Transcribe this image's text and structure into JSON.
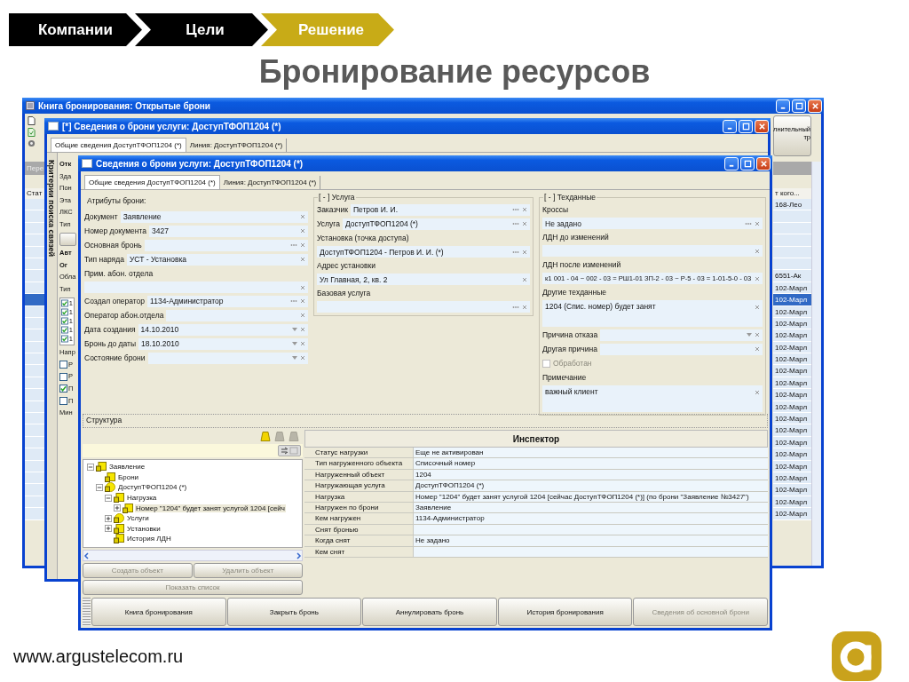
{
  "slide": {
    "breadcrumb": [
      {
        "label": "Компании",
        "selected": false
      },
      {
        "label": "Цели",
        "selected": false
      },
      {
        "label": "Решение",
        "selected": true
      }
    ],
    "title": "Бронирование ресурсов",
    "footer_url": "www.argustelecom.ru"
  },
  "back_window": {
    "title": "Книга бронирования: Открытые брони",
    "group_header": "Пере",
    "filter_button": [
      "лнительный",
      "тр"
    ],
    "columns": [
      {
        "header": "Стат"
      },
      {
        "header": "т кого..."
      }
    ],
    "rows": [
      {
        "column_2": "168-Лео",
        "selected": false
      },
      {
        "selected": false
      },
      {
        "selected": false
      },
      {
        "selected": false
      },
      {
        "selected": false
      },
      {
        "selected": false
      },
      {
        "column_2": "6551-Ак",
        "selected": false
      },
      {
        "column_2": "102-Марл",
        "selected": false
      },
      {
        "column_2": "102-Марл",
        "selected": true
      },
      {
        "column_2": "102-Марл",
        "selected": false
      },
      {
        "column_2": "102-Марл",
        "selected": false
      },
      {
        "column_2": "102-Марл",
        "selected": false
      },
      {
        "column_2": "102-Марл",
        "selected": false
      },
      {
        "column_2": "102-Марл",
        "selected": false
      },
      {
        "column_2": "102-Марл",
        "selected": false
      },
      {
        "column_2": "102-Марл",
        "selected": false
      },
      {
        "column_2": "102-Марл",
        "selected": false
      },
      {
        "column_2": "102-Марл",
        "selected": false
      },
      {
        "column_2": "102-Марл",
        "selected": false
      },
      {
        "column_2": "102-Марл",
        "selected": false
      },
      {
        "column_2": "102-Марл",
        "selected": false
      },
      {
        "column_2": "102-Марл",
        "selected": false
      },
      {
        "column_2": "102-Марл",
        "selected": false
      },
      {
        "column_2": "102-Марл",
        "selected": false
      },
      {
        "column_2": "102-Марл",
        "selected": false
      },
      {
        "column_2": "102-Марл",
        "selected": false
      },
      {
        "column_2": "102-Марл",
        "selected": false
      }
    ]
  },
  "middle_window": {
    "title": "[*] Сведения о брони услуги: ДоступТФОП1204 (*)",
    "tabs": [
      {
        "label": "Общие сведения  ДоступТФОП1204 (*)",
        "selected": true
      },
      {
        "label": "Линия: ДоступТФОП1204 (*)",
        "selected": false
      }
    ],
    "side_tab": "Критерии поиска связей",
    "filter_panel": [
      {
        "kind": "heading",
        "text": "Отк"
      },
      {
        "kind": "label",
        "text": "Зда"
      },
      {
        "kind": "label",
        "text": "Пон"
      },
      {
        "kind": "label",
        "text": "Эта"
      },
      {
        "kind": "label",
        "text": "ЛКС"
      },
      {
        "kind": "label",
        "text": "Тип"
      },
      {
        "kind": "button"
      },
      {
        "kind": "heading",
        "text": "Авт"
      },
      {
        "kind": "heading",
        "text": "Ог"
      },
      {
        "kind": "label",
        "text": "Обла"
      },
      {
        "kind": "label",
        "text": "Тип"
      },
      {
        "kind": "checklist",
        "items": [
          {
            "label": "1",
            "checked": true
          },
          {
            "label": "1",
            "checked": true
          },
          {
            "label": "1",
            "checked": true
          },
          {
            "label": "1",
            "checked": true
          },
          {
            "label": "1",
            "checked": true
          }
        ]
      },
      {
        "kind": "label",
        "text": "Напр"
      },
      {
        "kind": "checkbox",
        "text": "Р",
        "checked": false
      },
      {
        "kind": "checkbox",
        "text": "Р",
        "checked": false
      },
      {
        "kind": "checkbox",
        "text": "П",
        "checked": true
      },
      {
        "kind": "checkbox",
        "text": "П",
        "checked": false
      },
      {
        "kind": "label",
        "text": "Мин"
      }
    ]
  },
  "front_window": {
    "title": "Сведения о брони услуги: ДоступТФОП1204 (*)",
    "tabs": [
      {
        "label": "Общие сведения  ДоступТФОП1204 (*)",
        "selected": true
      },
      {
        "label": "Линия: ДоступТФОП1204 (*)",
        "selected": false
      }
    ],
    "attributes": {
      "title": "Атрибуты брони:",
      "fields": [
        {
          "kind": "inline",
          "label": "Документ",
          "value": "Заявление",
          "lookup": false,
          "dropdown": false
        },
        {
          "kind": "inline",
          "label": "Номер документа",
          "value": "3427",
          "lookup": false,
          "dropdown": false
        },
        {
          "kind": "inline",
          "label": "Основная бронь",
          "lookup": true,
          "dropdown": false
        },
        {
          "kind": "inline",
          "label": "Тип наряда",
          "value": "УСТ - Установка",
          "lookup": false,
          "dropdown": false
        },
        {
          "kind": "stacked",
          "label": "Прим. абон. отдела",
          "lookup": false,
          "dropdown": false
        },
        {
          "kind": "inline",
          "label": "Создал оператор",
          "value": "1134-Администратор",
          "lookup": true,
          "dropdown": false
        },
        {
          "kind": "inline",
          "label": "Оператор абон.отдела",
          "lookup": false,
          "dropdown": false
        },
        {
          "kind": "inline",
          "label": "Дата создания",
          "value": "14.10.2010",
          "lookup": false,
          "dropdown": true
        },
        {
          "kind": "inline",
          "label": "Бронь до даты",
          "value": "18.10.2010",
          "lookup": false,
          "dropdown": true
        },
        {
          "kind": "inline",
          "label": "Состояние брони",
          "lookup": false,
          "dropdown": true
        }
      ]
    },
    "service_group": {
      "title": "[ - ] Услуга",
      "fields": [
        {
          "kind": "inline",
          "label": "Заказчик",
          "value": "Петров И. И.",
          "lookup": true,
          "dropdown": false
        },
        {
          "kind": "inline",
          "label": "Услуга",
          "value": "ДоступТФОП1204 (*)",
          "lookup": true,
          "dropdown": false
        },
        {
          "kind": "stacked",
          "label": "Установка (точка доступа)",
          "value": "ДоступТФОП1204 - Петров И. И. (*)",
          "lookup": true,
          "dropdown": false
        },
        {
          "kind": "stacked",
          "label": "Адрес установки",
          "value": "Ул Главная, 2, кв. 2",
          "lookup": false,
          "dropdown": false
        },
        {
          "kind": "stacked",
          "label": "Базовая услуга",
          "lookup": true,
          "dropdown": false
        }
      ]
    },
    "tech_group": {
      "title": "[ - ] Техданные",
      "fields": [
        {
          "kind": "stacked",
          "label": "Кроссы",
          "value": "Не задано",
          "lookup": true,
          "dropdown": false
        },
        {
          "kind": "stacked",
          "label": "ЛДН  до изменений",
          "lookup": false,
          "dropdown": false
        },
        {
          "kind": "stacked",
          "label": "ЛДН  после изменений",
          "value": "к1 001 - 04 ~ 002 - 03 = РШ1-01 ЗП-2 - 03 ~ Р-5 - 03 = 1-01-5-0 - 03",
          "lookup": false,
          "dropdown": false
        },
        {
          "kind": "memo",
          "label": "Другие техданные",
          "value": "1204 (Спис. номер) будет занят",
          "lookup": false,
          "dropdown": false
        },
        {
          "kind": "inline",
          "label": "Причина отказа",
          "lookup": false,
          "dropdown": true
        },
        {
          "kind": "inline",
          "label": "Другая причина",
          "lookup": false,
          "dropdown": false
        },
        {
          "kind": "checkbox",
          "label": "Обработан",
          "checked": false,
          "disabled": true
        },
        {
          "kind": "memo",
          "label": "Примечание",
          "value": "важный клиент",
          "lookup": false,
          "dropdown": false
        }
      ]
    },
    "structure": {
      "title": "Структура",
      "toolbar": [
        {
          "disabled": false
        },
        {
          "disabled": true
        },
        {
          "disabled": true
        }
      ],
      "tree": [
        {
          "label": "Заявление",
          "kind": "document",
          "expandable": true,
          "expanded": true,
          "selected": false,
          "children": [
            {
              "label": "Брони",
              "kind": "document",
              "expandable": false,
              "expanded": false,
              "selected": false
            },
            {
              "label": "ДоступТФОП1204 (*)",
              "kind": "service",
              "expandable": true,
              "expanded": true,
              "selected": false,
              "children": [
                {
                  "label": "Нагрузка",
                  "kind": "document",
                  "expandable": true,
                  "expanded": true,
                  "selected": false,
                  "children": [
                    {
                      "label": "Номер \"1204\" будет занят услугой 1204 [сейч",
                      "kind": "document",
                      "expandable": true,
                      "expanded": false,
                      "selected": true
                    }
                  ]
                },
                {
                  "label": "Услуги",
                  "kind": "service",
                  "expandable": true,
                  "expanded": false,
                  "selected": false
                },
                {
                  "label": "Установки",
                  "kind": "document",
                  "expandable": true,
                  "expanded": false,
                  "selected": false
                },
                {
                  "label": "История ЛДН",
                  "kind": "document",
                  "expandable": false,
                  "expanded": false,
                  "selected": false
                }
              ]
            }
          ]
        }
      ],
      "buttons": [
        {
          "label": "Создать объект",
          "disabled": true
        },
        {
          "label": "Удалить объект",
          "disabled": true
        }
      ],
      "list_button": {
        "label": "Показать список",
        "disabled": true
      }
    },
    "inspector": {
      "title": "Инспектор",
      "rows": [
        {
          "name": "Статус нагрузки",
          "value": "Еще не активирован"
        },
        {
          "name": "Тип нагруженного объекта",
          "value": "Списочный номер"
        },
        {
          "name": "Нагруженный объект",
          "value": "1204"
        },
        {
          "name": "Нагружающая услуга",
          "value": "ДоступТФОП1204 (*)"
        },
        {
          "name": "Нагрузка",
          "value": "Номер \"1204\" будет занят услугой 1204 [сейчас ДоступТФОП1204 (*)] (по брони \"Заявление №3427\")"
        },
        {
          "name": "Нагружен по брони",
          "value": "Заявление"
        },
        {
          "name": "Кем нагружен",
          "value": "1134-Администратор"
        },
        {
          "name": "Снят бронью"
        },
        {
          "name": "Когда снят",
          "value": "Не задано"
        },
        {
          "name": "Кем снят"
        }
      ]
    },
    "bottom_buttons": [
      {
        "label": "Книга бронирования",
        "disabled": false
      },
      {
        "label": "Закрыть бронь",
        "disabled": false
      },
      {
        "label": "Аннулировать бронь",
        "disabled": false
      },
      {
        "label": "История бронирования",
        "disabled": false
      },
      {
        "label": "Сведения об основной брони",
        "disabled": true
      }
    ]
  }
}
